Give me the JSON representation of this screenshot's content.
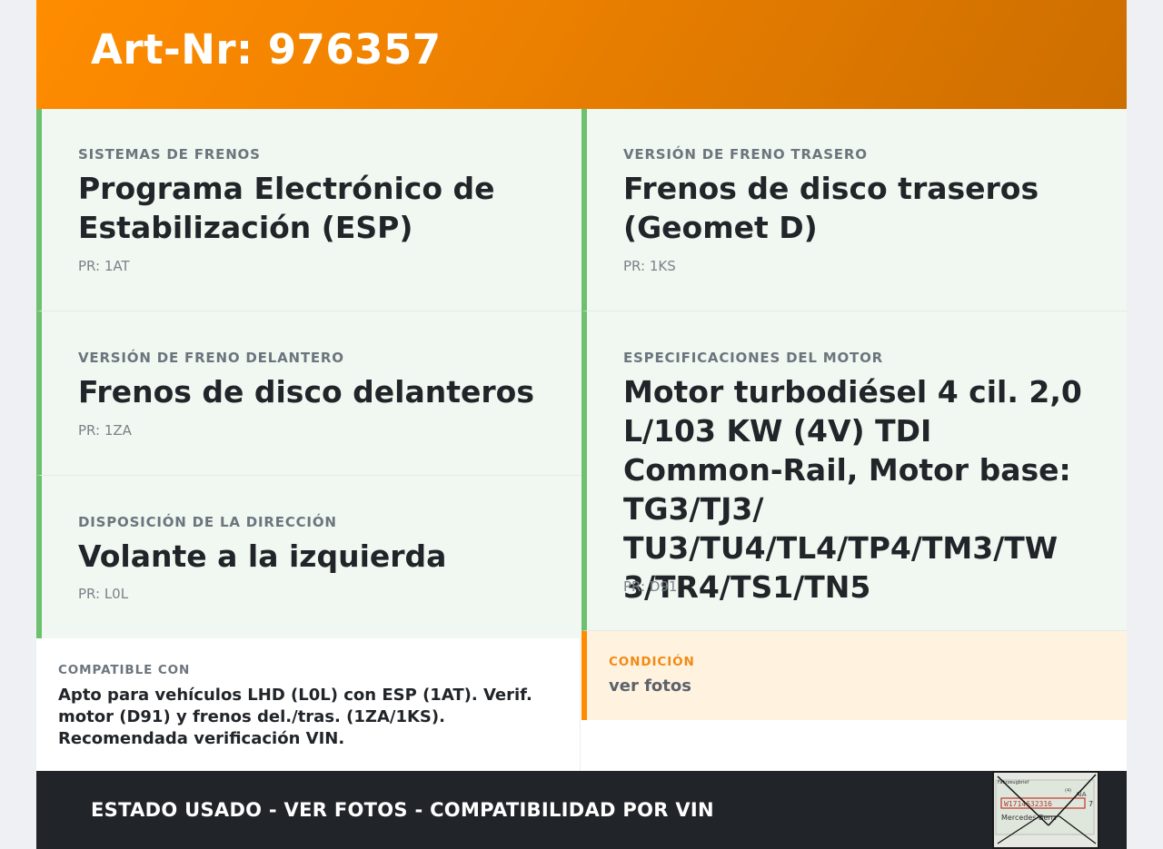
{
  "header": {
    "title": "Art-Nr: 976357"
  },
  "cards": {
    "braking_system": {
      "label": "SISTEMAS DE FRENOS",
      "value": "Programa Electrónico de Estabilización (ESP)",
      "pr": "PR: 1AT"
    },
    "rear_brake": {
      "label": "VERSIÓN DE FRENO TRASERO",
      "value": "Frenos de disco traseros (Geomet D)",
      "pr": "PR: 1KS"
    },
    "front_brake": {
      "label": "VERSIÓN DE FRENO DELANTERO",
      "value": "Frenos de disco delanteros",
      "pr": "PR: 1ZA"
    },
    "engine": {
      "label": "ESPECIFICACIONES DEL MOTOR",
      "value": "Motor turbodiésel 4 cil. 2,0 L/103 KW (4V) TDI Common-Rail, Motor base: TG3/TJ3/ TU3/TU4/TL4/TP4/TM3/TW 3/TR4/TS1/TN5",
      "pr": "PR: D91"
    },
    "steering": {
      "label": "DISPOSICIÓN DE LA DIRECCIÓN",
      "value": "Volante a la izquierda",
      "pr": "PR: L0L"
    }
  },
  "compatible": {
    "label": "COMPATIBLE CON",
    "text": "Apto para vehículos LHD (L0L) con ESP (1AT). Verif. motor (D91) y frenos del./tras. (1ZA/1KS). Recomendada verificación VIN."
  },
  "condition": {
    "label": "CONDICIÓN",
    "text": "ver fotos"
  },
  "footer": {
    "text": "ESTADO USADO - VER FOTOS - COMPATIBILIDAD POR VIN"
  },
  "thumbnail": {
    "caption": "Fahrzeugbrief",
    "code": "W1714632316",
    "brand": "Mercedes-Benz",
    "letters": "AiA"
  },
  "colors": {
    "header_gradient_start": "#ff8c00",
    "header_gradient_end": "#cc6e00",
    "card_accent": "#6cc070",
    "card_background": "#f1f8f1",
    "condition_accent": "#ff8c00",
    "condition_background": "#fff3e0",
    "footer_background": "#212529"
  }
}
